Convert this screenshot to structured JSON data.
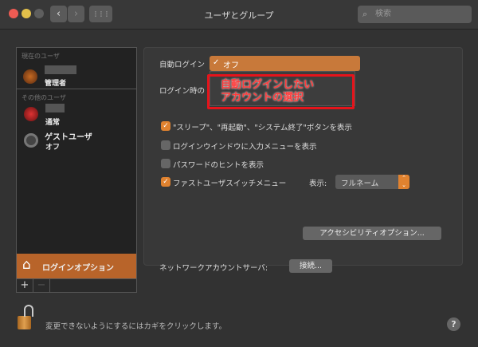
{
  "window": {
    "title": "ユーザとグループ",
    "search_placeholder": "検索",
    "back": "‹",
    "forward": "›",
    "grid": "⋮⋮⋮"
  },
  "sidebar": {
    "current_header": "現在のユーザ",
    "current_user": {
      "role": "管理者"
    },
    "other_header": "その他のユーザ",
    "other_users": [
      {
        "role": "通常"
      },
      {
        "name": "ゲストユーザ",
        "role": "オフ"
      }
    ],
    "login_options": "ログインオプション",
    "add": "+",
    "remove": "−"
  },
  "panel": {
    "auto_login_label": "自動ログイン",
    "auto_login_value": "オフ",
    "auto_login_check": "✓",
    "login_window_label": "ログイン時の",
    "annotation": [
      "自動ログインしたい",
      "アカウントの選択"
    ],
    "checkboxes": [
      {
        "label": "\"スリープ\"、\"再起動\"、\"システム終了\"ボタンを表示",
        "checked": true
      },
      {
        "label": "ログインウインドウに入力メニューを表示",
        "checked": false
      },
      {
        "label": "パスワードのヒントを表示",
        "checked": false
      },
      {
        "label": "ファストユーザスイッチメニュー",
        "checked": true
      }
    ],
    "display_label": "表示:",
    "display_value": "フルネーム",
    "accessibility_button": "アクセシビリティオプション...",
    "network_label": "ネットワークアカウントサーバ:",
    "connect_button": "接続..."
  },
  "footer": {
    "lock_text": "変更できないようにするにはカギをクリックします。",
    "help": "?"
  },
  "colors": {
    "accent": "#e0822f",
    "selection": "#b8642a",
    "annotation": "#e5141b"
  }
}
